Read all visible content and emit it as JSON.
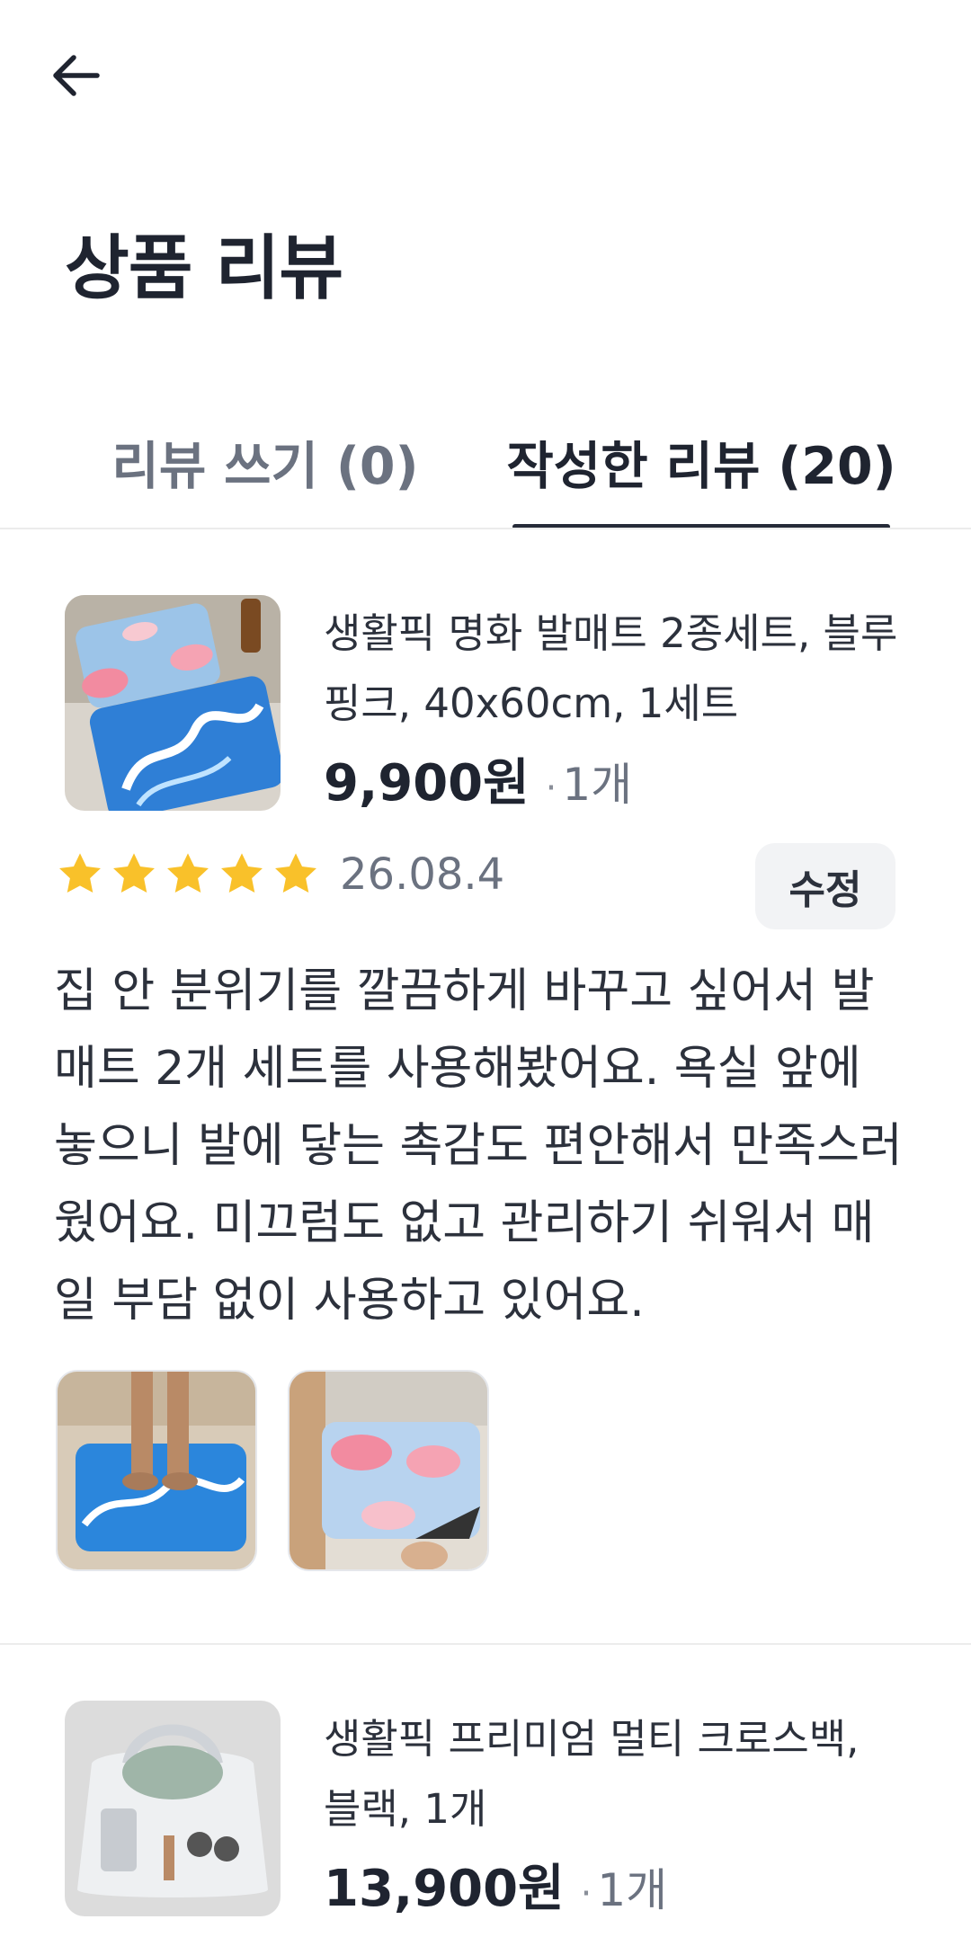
{
  "header": {
    "back_icon": "arrow-left-icon",
    "title": "상품 리뷰"
  },
  "tabs": [
    {
      "label": "리뷰 쓰기 (0)",
      "active": false
    },
    {
      "label": "작성한 리뷰 (20)",
      "active": true
    }
  ],
  "colors": {
    "text": "#1f2430",
    "muted": "#6b7280",
    "star": "#f9c12a",
    "tab_underline": "#262b38",
    "chip_bg": "#f2f3f5"
  },
  "reviews": [
    {
      "product_name": "생활픽 명화 발매트 2종세트, 블루핑크, 40x60cm, 1세트",
      "price": "9,900원",
      "quantity": "1개",
      "rating": 5,
      "date": "26.08.4",
      "edit_label": "수정",
      "text": "집 안 분위기를 깔끔하게 바꾸고 싶어서 발매트 2개 세트를 사용해봤어요. 욕실 앞에 놓으니 발에 닿는 촉감도 편안해서 만족스러웠어요. 미끄럼도 없고 관리하기 쉬워서 매일 부담 없이 사용하고 있어요.",
      "photos": 2
    },
    {
      "product_name": "생활픽 프리미엄 멀티 크로스백, 블랙, 1개",
      "price": "13,900원",
      "quantity": "1개"
    }
  ]
}
